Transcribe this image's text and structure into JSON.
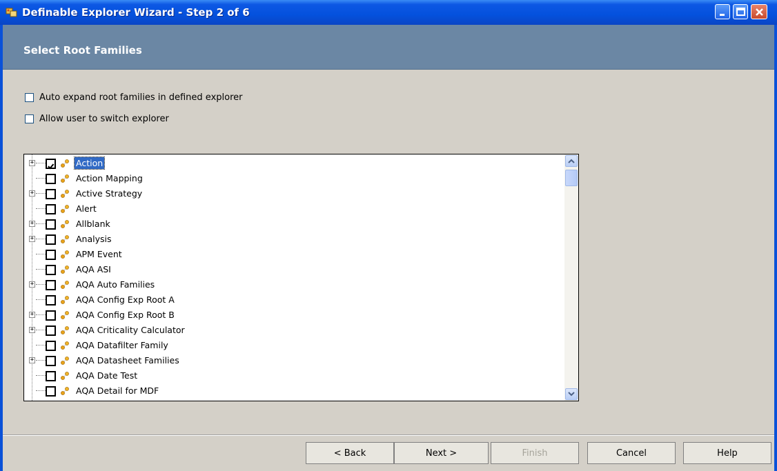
{
  "window": {
    "title": "Definable Explorer Wizard - Step 2 of 6"
  },
  "header": {
    "title": "Select Root Families"
  },
  "options": [
    {
      "label": "Auto expand root families in defined explorer",
      "checked": false
    },
    {
      "label": "Allow user to switch explorer",
      "checked": false
    }
  ],
  "tree": {
    "items": [
      {
        "label": "Action",
        "checked": true,
        "expandable": true,
        "selected": true
      },
      {
        "label": "Action Mapping",
        "checked": false,
        "expandable": false
      },
      {
        "label": "Active Strategy",
        "checked": false,
        "expandable": true
      },
      {
        "label": "Alert",
        "checked": false,
        "expandable": false
      },
      {
        "label": "Allblank",
        "checked": false,
        "expandable": true
      },
      {
        "label": "Analysis",
        "checked": false,
        "expandable": true
      },
      {
        "label": "APM Event",
        "checked": false,
        "expandable": false
      },
      {
        "label": "AQA ASI",
        "checked": false,
        "expandable": false
      },
      {
        "label": "AQA Auto Families",
        "checked": false,
        "expandable": true
      },
      {
        "label": "AQA Config Exp Root A",
        "checked": false,
        "expandable": false
      },
      {
        "label": "AQA Config Exp Root B",
        "checked": false,
        "expandable": true
      },
      {
        "label": "AQA Criticality Calculator",
        "checked": false,
        "expandable": true
      },
      {
        "label": "AQA Datafilter Family",
        "checked": false,
        "expandable": false
      },
      {
        "label": "AQA Datasheet Families",
        "checked": false,
        "expandable": true
      },
      {
        "label": "AQA Date Test",
        "checked": false,
        "expandable": false
      },
      {
        "label": "AQA Detail for MDF",
        "checked": false,
        "expandable": false
      }
    ]
  },
  "buttons": {
    "back": "< Back",
    "next": "Next >",
    "finish": "Finish",
    "cancel": "Cancel",
    "help": "Help"
  }
}
